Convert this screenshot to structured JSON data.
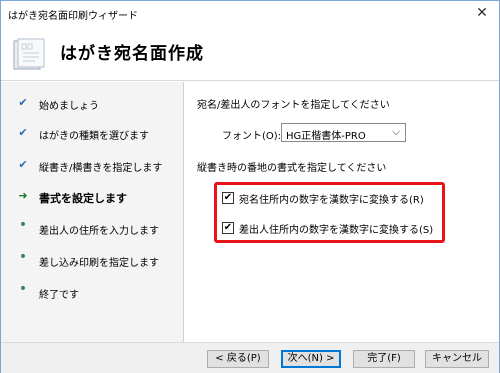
{
  "window": {
    "title": "はがき宛名面印刷ウィザード",
    "close_glyph": "✕"
  },
  "header": {
    "heading": "はがき宛名面作成",
    "icon": "wizard-postcard-icon"
  },
  "sidebar": {
    "steps": [
      {
        "label": "始めましょう",
        "state": "done",
        "glyph": "✔"
      },
      {
        "label": "はがきの種類を選びます",
        "state": "done",
        "glyph": "✔"
      },
      {
        "label": "縦書き/横書きを指定します",
        "state": "done",
        "glyph": "✔"
      },
      {
        "label": "書式を設定します",
        "state": "current",
        "glyph": "➜"
      },
      {
        "label": "差出人の住所を入力します",
        "state": "todo",
        "glyph": "•"
      },
      {
        "label": "差し込み印刷を指定します",
        "state": "todo",
        "glyph": "•"
      },
      {
        "label": "終了です",
        "state": "todo",
        "glyph": "•"
      }
    ]
  },
  "content": {
    "font_section": "宛名/差出人のフォントを指定してください",
    "font_label": "フォント(O):",
    "font_value": "HG正楷書体-PRO",
    "number_section": "縦書き時の番地の書式を指定してください",
    "checkboxes": [
      {
        "label": "宛名住所内の数字を漢数字に変換する(R)",
        "checked": true,
        "glyph": "✔"
      },
      {
        "label": "差出人住所内の数字を漢数字に変換する(S)",
        "checked": true,
        "glyph": "✔"
      }
    ],
    "highlight_color": "#e8121a"
  },
  "footer": {
    "back": "< 戻る(P)",
    "next": "次へ(N) >",
    "finish": "完了(F)",
    "cancel": "キャンセル"
  }
}
